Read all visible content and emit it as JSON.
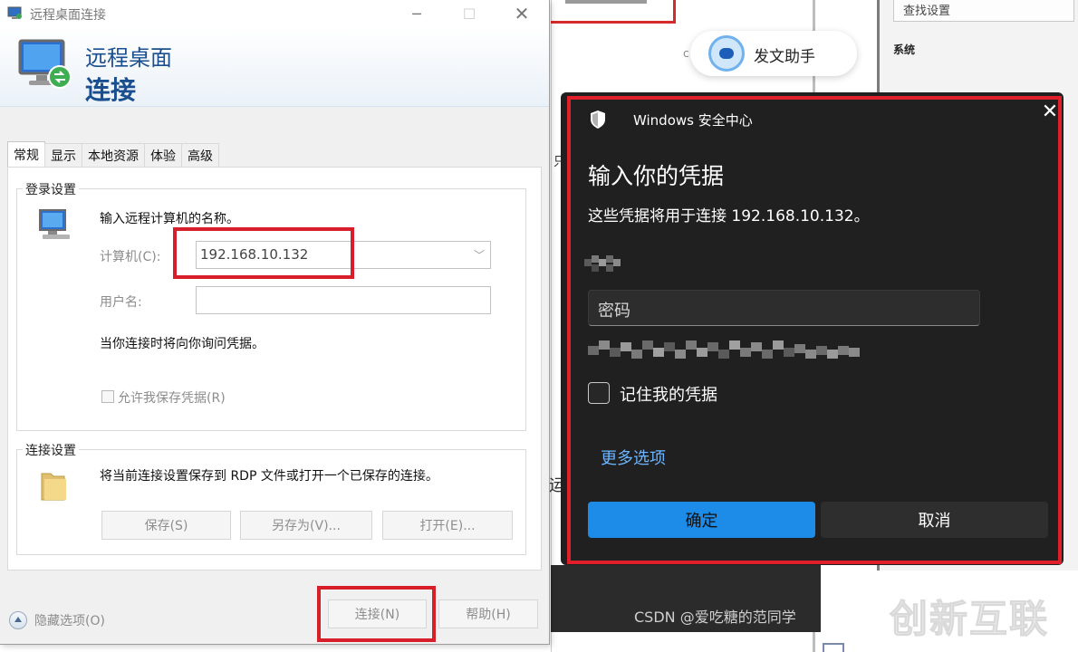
{
  "background": {
    "settings_search_placeholder": "查找设置",
    "settings_section_label": "系统",
    "assistant_label": "发文助手",
    "assistant_stray": "c",
    "stray_text_1": "只",
    "stray_text_2": "运",
    "watermark_csdn": "CSDN @爱吃糖的范同学",
    "watermark_brand": "创新互联"
  },
  "rdp": {
    "window_title": "远程桌面连接",
    "banner_line1": "远程桌面",
    "banner_line2": "连接",
    "tabs": [
      "常规",
      "显示",
      "本地资源",
      "体验",
      "高级"
    ],
    "active_tab": "常规",
    "login_group_title": "登录设置",
    "login_hint": "输入远程计算机的名称。",
    "computer_label": "计算机(C):",
    "computer_value": "192.168.10.132",
    "username_label": "用户名:",
    "username_value": "",
    "credentials_note": "当你连接时将向你询问凭据。",
    "allow_save_label": "允许我保存凭据(R)",
    "connection_group_title": "连接设置",
    "connection_hint": "将当前连接设置保存到 RDP 文件或打开一个已保存的连接。",
    "save_label": "保存(S)",
    "save_as_label": "另存为(V)...",
    "open_label": "打开(E)...",
    "hide_options_label": "隐藏选项(O)",
    "connect_label": "连接(N)",
    "help_label": "帮助(H)"
  },
  "security": {
    "app_name": "Windows 安全中心",
    "heading": "输入你的凭据",
    "description": "这些凭据将用于连接 192.168.10.132。",
    "password_placeholder": "密码",
    "remember_label": "记住我的凭据",
    "more_options": "更多选项",
    "ok_label": "确定",
    "cancel_label": "取消"
  },
  "colors": {
    "accent_blue": "#1c8ce8",
    "link_blue": "#6cb4ff",
    "highlight_red": "#e11f2b",
    "dark_bg": "#202020"
  }
}
